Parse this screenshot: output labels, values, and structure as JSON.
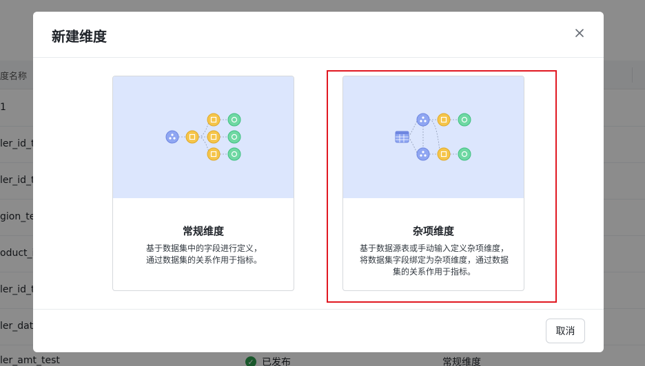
{
  "background": {
    "column_header": "度名称",
    "rows": [
      "1",
      "ler_id_te",
      "ler_id_t",
      "gion_tes",
      "oduct_ic",
      "ler_id_t",
      "ler_dat",
      "ler_amt_test"
    ],
    "status_label": "已发布",
    "type_label": "常规维度"
  },
  "modal": {
    "title": "新建维度",
    "close_icon": "close-icon",
    "cards": [
      {
        "title": "常规维度",
        "desc_line1": "基于数据集中的字段进行定义，",
        "desc_line2": "通过数据集的关系作用于指标。"
      },
      {
        "title": "杂项维度",
        "desc_line1": "基于数据源表或手动输入定义杂项维度，",
        "desc_line2": "将数据集字段绑定为杂项维度，通过数据",
        "desc_line3": "集的关系作用于指标。"
      }
    ],
    "cancel_label": "取消"
  },
  "colors": {
    "highlight": "#e0161f",
    "illustration_bg": "#dce6fd",
    "node_blue": "#8fa6f2",
    "node_yellow": "#f5c54a",
    "node_green": "#6fd8a3"
  }
}
